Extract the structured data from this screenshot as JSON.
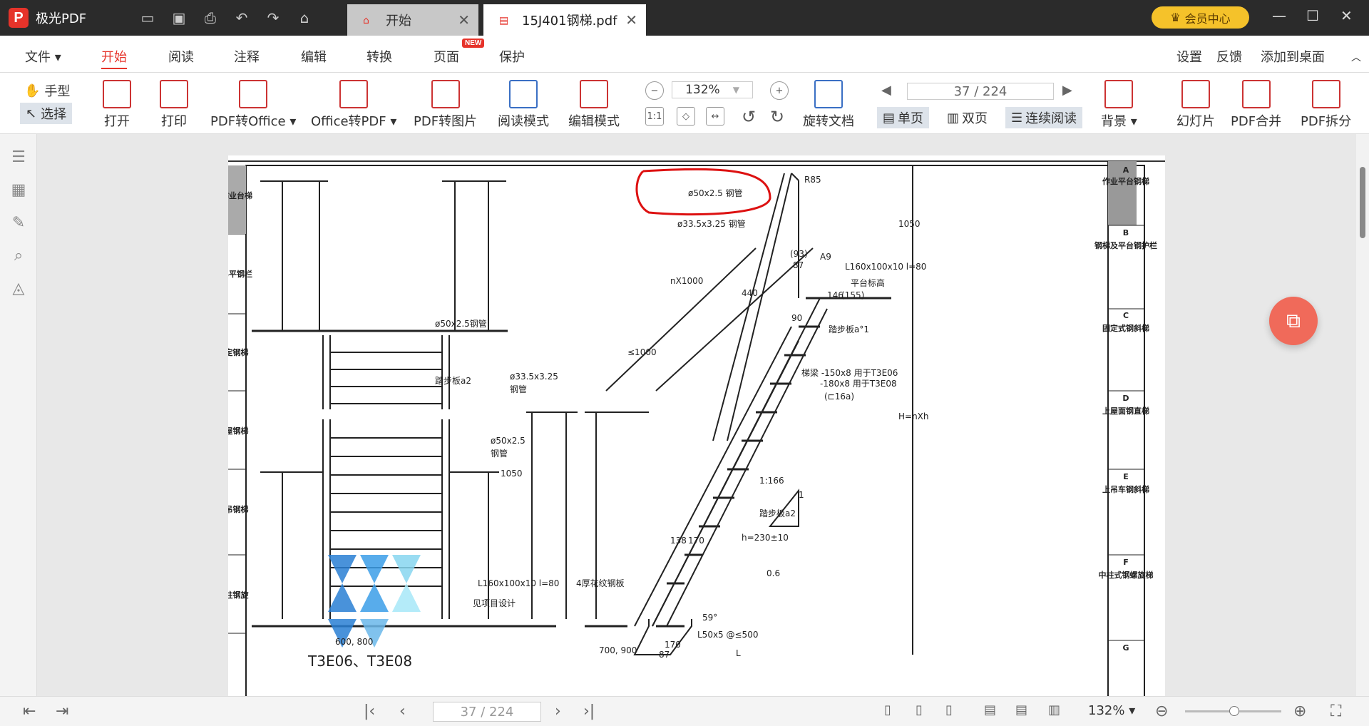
{
  "app": {
    "name": "极光PDF"
  },
  "tabs": [
    {
      "label": "开始"
    },
    {
      "label": "15J401钢梯.pdf"
    }
  ],
  "vip": "会员中心",
  "menu": {
    "items": [
      "文件",
      "开始",
      "阅读",
      "注释",
      "编辑",
      "转换",
      "页面",
      "保护"
    ],
    "badge": "NEW",
    "right": [
      "设置",
      "反馈",
      "添加到桌面"
    ]
  },
  "toolbar": {
    "hand": "手型",
    "select": "选择",
    "open": "打开",
    "print": "打印",
    "pdf2office": "PDF转Office",
    "office2pdf": "Office转PDF",
    "pdf2img": "PDF转图片",
    "readmode": "阅读模式",
    "editmode": "编辑模式",
    "zoom": "132%",
    "page": "37 / 224",
    "rotate": "旋转文档",
    "single": "单页",
    "double": "双页",
    "continuous": "连续阅读",
    "background": "背景",
    "slideshow": "幻灯片",
    "merge": "PDF合并",
    "split": "PDF拆分"
  },
  "drawing": {
    "side_tabs": [
      "作业平台钢梯",
      "钢梯及平台钢护栏",
      "固定式钢斜梯",
      "上屋面钢直梯",
      "上吊车钢斜梯",
      "中柱式钢螺旋梯"
    ],
    "side_letters": [
      "A",
      "B",
      "C",
      "D",
      "E",
      "F",
      "G"
    ],
    "left_strip": [
      "作业台梯",
      "弟平钢栏",
      "定钢梯",
      "屋钢梯",
      "吊钢梯",
      "柱钢旋"
    ],
    "labels": {
      "pipe50": "ø50x2.5 钢管",
      "pipe33": "ø33.5x3.25 钢管",
      "pipe50b": "ø50x2.5钢管",
      "tread_a2": "踏步板a2",
      "pipe33b": "ø33.5x3.25",
      "steelpipe": "钢管",
      "pipe50c": "ø50x2.5",
      "dim1050": "1050",
      "L160": "L160x100x10 l=80",
      "see": "见项目设计",
      "dim600": "600, 800",
      "title": "T3E06、T3E08",
      "plate": "4厚花纹钢板",
      "L50": "L50x5 @≤500",
      "dim700": "700, 900",
      "dim170": "170",
      "dim87": "87",
      "L": "L",
      "platform": "平台标高",
      "tread_a1": "踏步板a°1",
      "beam1": "梯梁 -150x8 用于T3E06",
      "beam2": "-180x8 用于T3E08",
      "beam3": "(⊏16a)",
      "tread_a2b": "踏步板a2",
      "h230": "h=230±10",
      "ratio": "1:166",
      "r1": "1",
      "r06": "0.6",
      "d138": "138",
      "d170": "170",
      "deg59": "59°",
      "d440": "440",
      "d90": "90",
      "nx1000": "nX1000",
      "le1000": "≤1000",
      "d93": "(93)",
      "d87b": "87",
      "d146": "146",
      "d155": "(155)",
      "d1050b": "1050",
      "Hnxh": "H=nXh",
      "r85": "R85",
      "a9": "A9"
    }
  },
  "status": {
    "page": "37 / 224",
    "zoom": "132%"
  }
}
